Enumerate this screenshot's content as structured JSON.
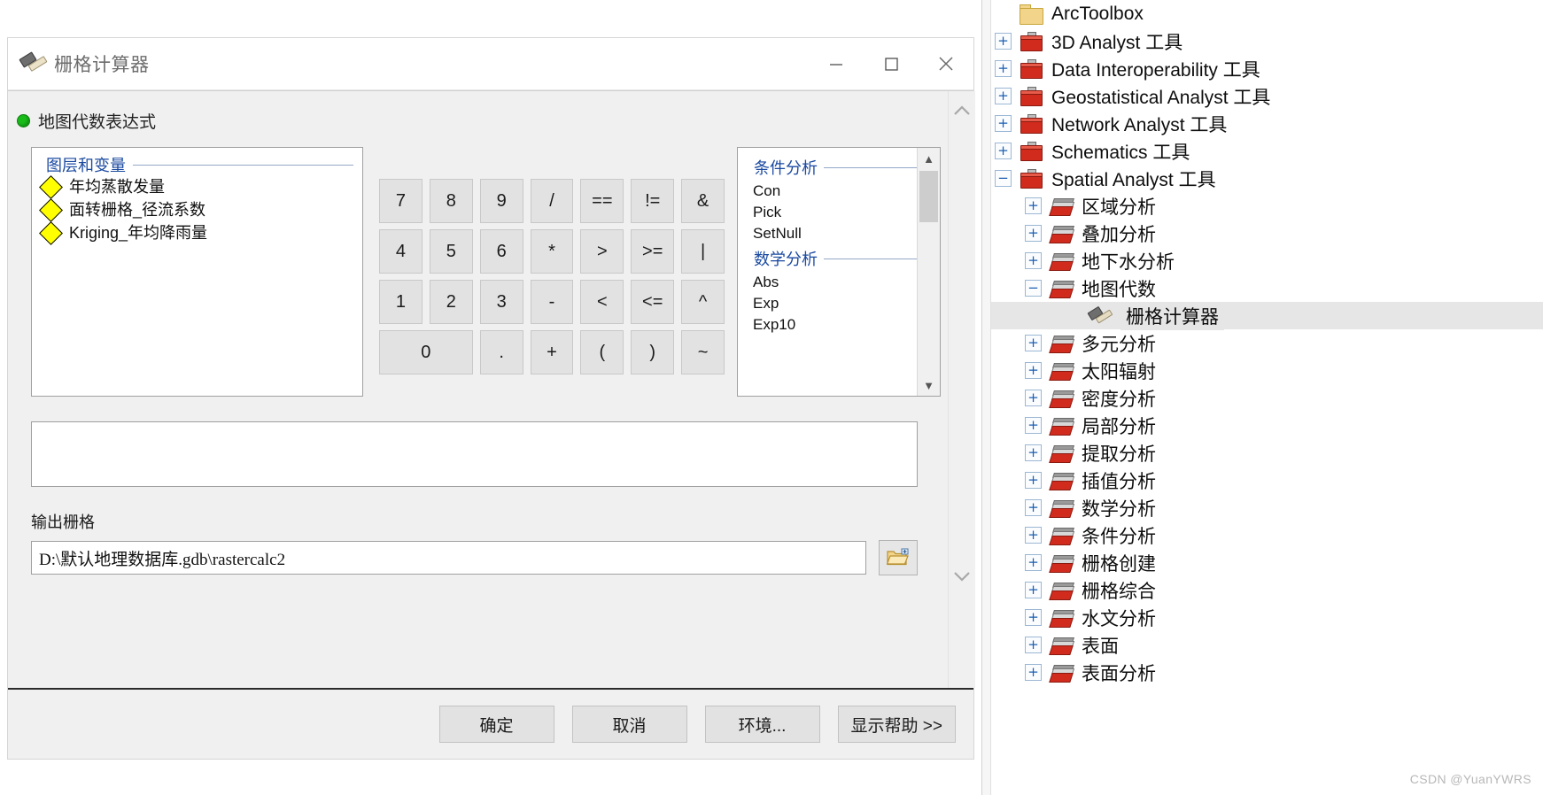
{
  "dialog": {
    "title": "栅格计算器",
    "title_icon": "hammer-icon",
    "caption": {
      "minimize": "—",
      "maximize": "▢",
      "close": "✕"
    },
    "expression_label": "地图代数表达式",
    "layers_panel": {
      "header": "图层和变量",
      "items": [
        {
          "label": "年均蒸散发量"
        },
        {
          "label": "面转栅格_径流系数"
        },
        {
          "label": "Kriging_年均降雨量"
        }
      ]
    },
    "keypad": [
      "7",
      "8",
      "9",
      "/",
      "==",
      "!=",
      "&",
      "4",
      "5",
      "6",
      "*",
      ">",
      ">=",
      "|",
      "1",
      "2",
      "3",
      "-",
      "<",
      "<=",
      "^",
      "0",
      ".",
      "+",
      "(",
      ")",
      "~"
    ],
    "functions": {
      "groups": [
        {
          "title": "条件分析",
          "items": [
            "Con",
            "Pick",
            "SetNull"
          ]
        },
        {
          "title": "数学分析",
          "items": [
            "Abs",
            "Exp",
            "Exp10"
          ]
        }
      ]
    },
    "expression_value": "",
    "output_label": "输出栅格",
    "output_value": "D:\\默认地理数据库.gdb\\rastercalc2",
    "browse_icon": "folder-open-icon",
    "buttons": [
      {
        "label": "确定"
      },
      {
        "label": "取消"
      },
      {
        "label": "环境..."
      },
      {
        "label": "显示帮助 >>"
      }
    ]
  },
  "toolbox": {
    "root": {
      "label": "ArcToolbox",
      "icon": "toolbox-folder-icon"
    },
    "nodes": [
      {
        "label": "3D Analyst 工具",
        "expander": "+",
        "icon": "red-toolbox-icon",
        "level": 1
      },
      {
        "label": "Data Interoperability 工具",
        "expander": "+",
        "icon": "red-toolbox-icon",
        "level": 1
      },
      {
        "label": "Geostatistical Analyst 工具",
        "expander": "+",
        "icon": "red-toolbox-icon",
        "level": 1
      },
      {
        "label": "Network Analyst 工具",
        "expander": "+",
        "icon": "red-toolbox-icon",
        "level": 1
      },
      {
        "label": "Schematics 工具",
        "expander": "+",
        "icon": "red-toolbox-icon",
        "level": 1
      },
      {
        "label": "Spatial Analyst 工具",
        "expander": "−",
        "icon": "red-toolbox-icon",
        "level": 1
      },
      {
        "label": "区域分析",
        "expander": "+",
        "icon": "toolset-icon",
        "level": 2
      },
      {
        "label": "叠加分析",
        "expander": "+",
        "icon": "toolset-icon",
        "level": 2
      },
      {
        "label": "地下水分析",
        "expander": "+",
        "icon": "toolset-icon",
        "level": 2
      },
      {
        "label": "地图代数",
        "expander": "−",
        "icon": "toolset-icon",
        "level": 2,
        "highlight": true
      },
      {
        "label": "栅格计算器",
        "expander": "",
        "icon": "hammer-tool-icon",
        "level": 3,
        "selected": true
      },
      {
        "label": "多元分析",
        "expander": "+",
        "icon": "toolset-icon",
        "level": 2
      },
      {
        "label": "太阳辐射",
        "expander": "+",
        "icon": "toolset-icon",
        "level": 2
      },
      {
        "label": "密度分析",
        "expander": "+",
        "icon": "toolset-icon",
        "level": 2
      },
      {
        "label": "局部分析",
        "expander": "+",
        "icon": "toolset-icon",
        "level": 2
      },
      {
        "label": "提取分析",
        "expander": "+",
        "icon": "toolset-icon",
        "level": 2
      },
      {
        "label": "插值分析",
        "expander": "+",
        "icon": "toolset-icon",
        "level": 2
      },
      {
        "label": "数学分析",
        "expander": "+",
        "icon": "toolset-icon",
        "level": 2
      },
      {
        "label": "条件分析",
        "expander": "+",
        "icon": "toolset-icon",
        "level": 2
      },
      {
        "label": "栅格创建",
        "expander": "+",
        "icon": "toolset-icon",
        "level": 2
      },
      {
        "label": "栅格综合",
        "expander": "+",
        "icon": "toolset-icon",
        "level": 2
      },
      {
        "label": "水文分析",
        "expander": "+",
        "icon": "toolset-icon",
        "level": 2
      },
      {
        "label": "表面",
        "expander": "+",
        "icon": "toolset-icon",
        "level": 2
      },
      {
        "label": "表面分析",
        "expander": "+",
        "icon": "toolset-icon",
        "level": 2
      }
    ]
  },
  "annotation": {
    "arrow_color": "#e8251d",
    "highlight_color": "#e8251d"
  },
  "watermark": "CSDN @YuanYWRS"
}
